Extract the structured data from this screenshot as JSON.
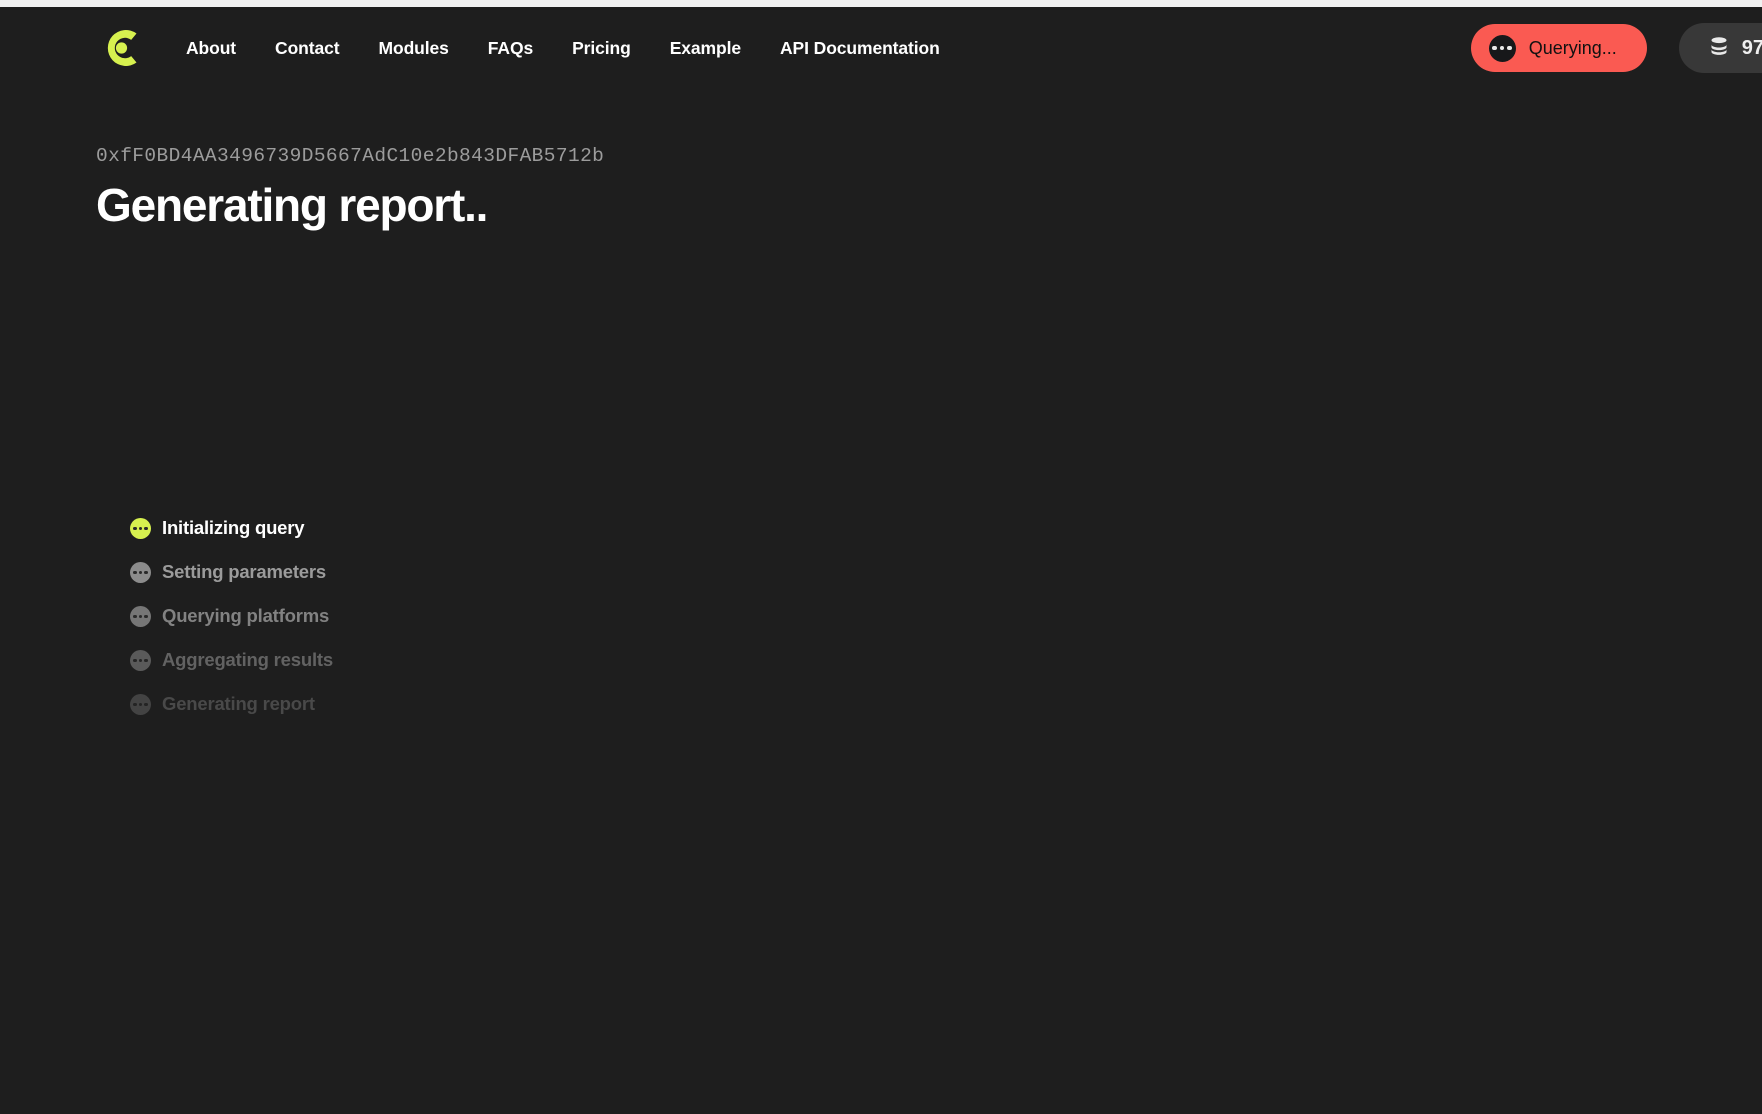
{
  "browser": {
    "chrome_strip": true
  },
  "header": {
    "logo": {
      "icon": "c-ring-logo",
      "color": "#d7f14f"
    },
    "nav": [
      {
        "label": "About",
        "name": "nav-about"
      },
      {
        "label": "Contact",
        "name": "nav-contact"
      },
      {
        "label": "Modules",
        "name": "nav-modules"
      },
      {
        "label": "FAQs",
        "name": "nav-faqs"
      },
      {
        "label": "Pricing",
        "name": "nav-pricing"
      },
      {
        "label": "Example",
        "name": "nav-example"
      },
      {
        "label": "API Documentation",
        "name": "nav-api-documentation"
      }
    ],
    "query_status": {
      "label": "Querying...",
      "icon": "three-dots-icon",
      "color": "#fa5a52",
      "text_color": "#111111"
    },
    "credits": {
      "count": "97",
      "icon": "database-stack-icon"
    }
  },
  "main": {
    "wallet_address": "0xfF0BD4AA3496739D5667AdC10e2b843DFAB5712b",
    "title": "Generating report..",
    "steps": [
      {
        "label": "Initializing query",
        "state": "active"
      },
      {
        "label": "Setting parameters",
        "state": "pending-1"
      },
      {
        "label": "Querying platforms",
        "state": "pending-2"
      },
      {
        "label": "Aggregating results",
        "state": "pending-3"
      },
      {
        "label": "Generating report",
        "state": "pending-4"
      }
    ]
  },
  "colors": {
    "background": "#1e1e1e",
    "accent_lime": "#d7f14f",
    "accent_red": "#fa5a52",
    "text_primary": "#ffffff",
    "text_muted": "#9c9c9c"
  }
}
